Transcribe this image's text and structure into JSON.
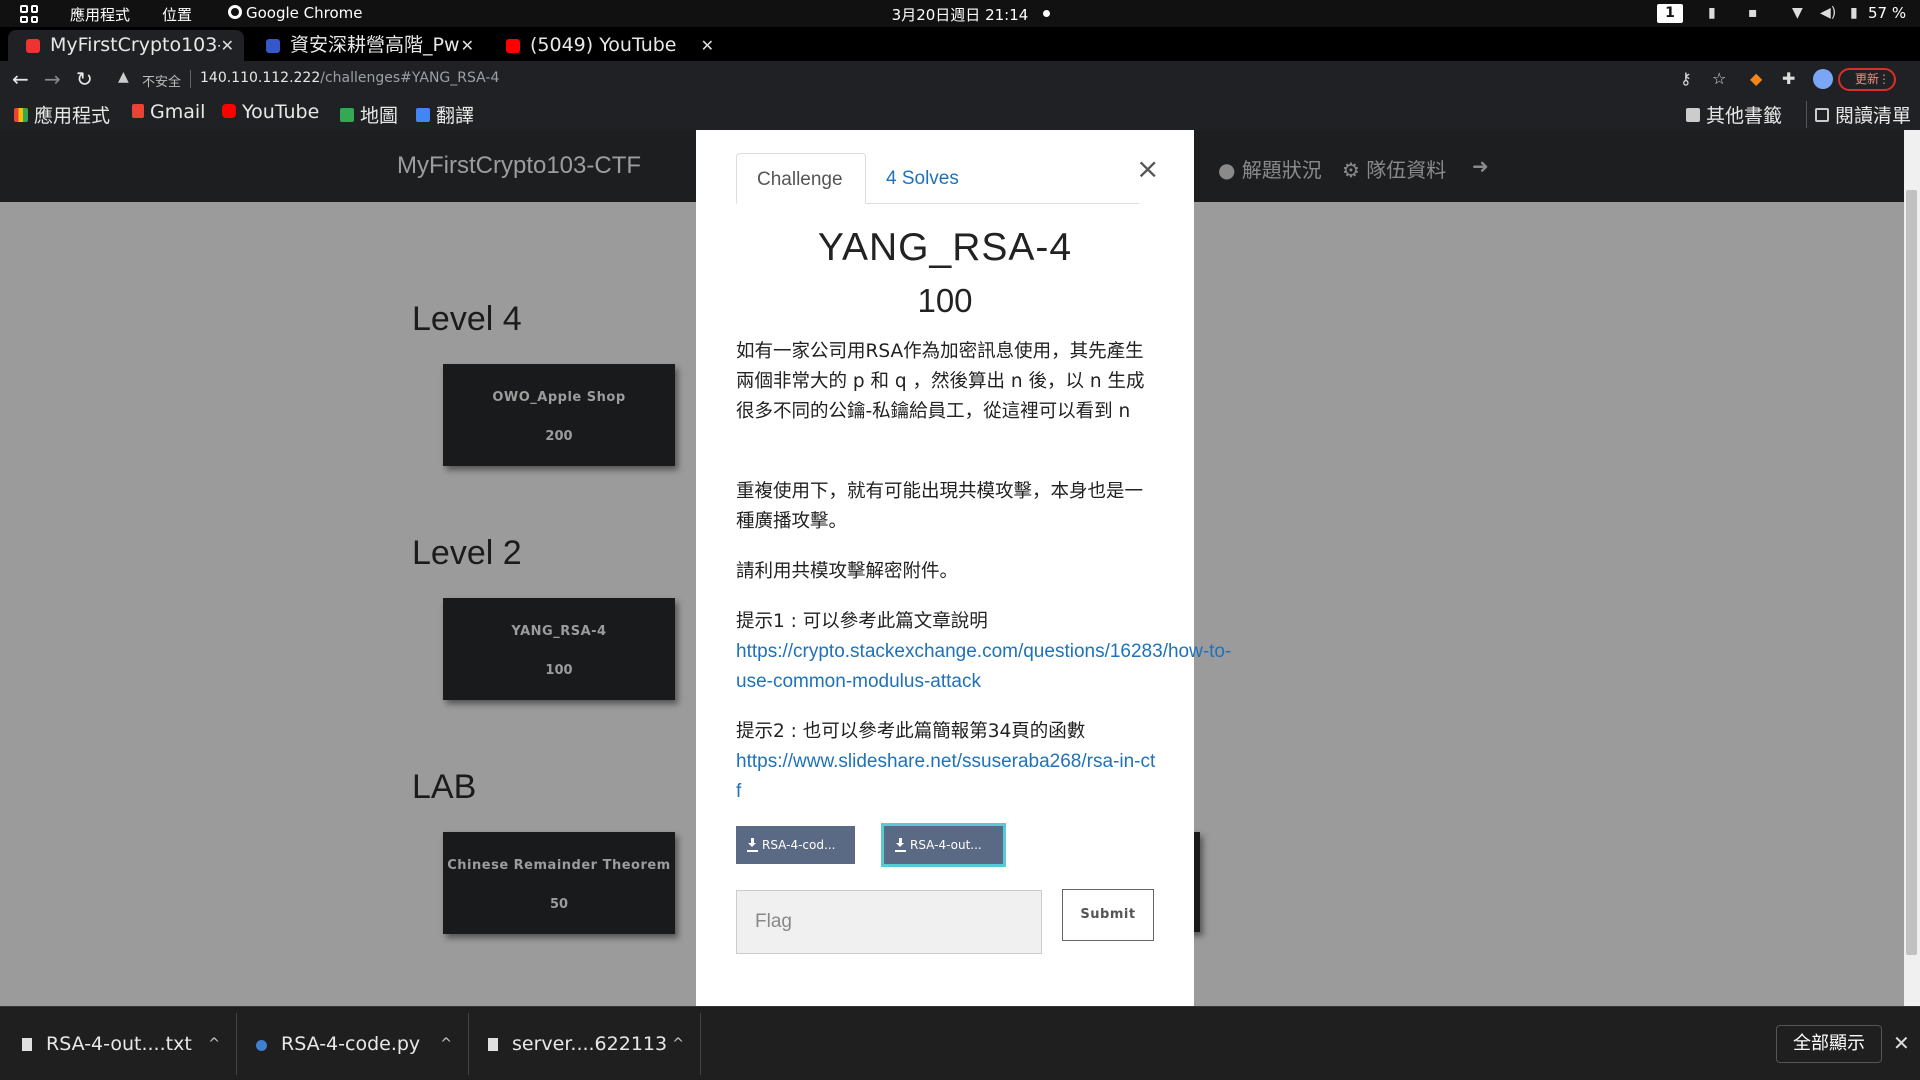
{
  "os_bar": {
    "apps_label": "應用程式",
    "places_label": "位置",
    "active_app": "Google Chrome",
    "clock": "3月20日週日  21:14",
    "workspace": "1",
    "battery": "57 %"
  },
  "tabs": [
    {
      "title": "MyFirstCrypto103-CTF",
      "active": true
    },
    {
      "title": "資安深耕營高階_Pw",
      "active": false
    },
    {
      "title": "(5049) YouTube",
      "active": false
    }
  ],
  "address_bar": {
    "security_label": "不安全",
    "url_host": "140.110.112.222",
    "url_path": "/challenges#YANG_RSA-4",
    "update_label": "更新"
  },
  "bookmarks": {
    "items": [
      "應用程式",
      "Gmail",
      "YouTube",
      "地圖",
      "翻譯"
    ],
    "other": "其他書籤",
    "reading_list": "閱讀清單"
  },
  "site": {
    "brand": "MyFirstCrypto103-CTF",
    "nav": [
      "解題狀況",
      "隊伍資料"
    ]
  },
  "levels": [
    {
      "title": "Level 4",
      "cards": [
        {
          "name": "OWO_Apple Shop",
          "value": "200"
        }
      ]
    },
    {
      "title": "Level 2",
      "cards": [
        {
          "name": "YANG_RSA-4",
          "value": "100"
        }
      ]
    },
    {
      "title": "LAB",
      "cards": [
        {
          "name": "Chinese Remainder Theorem",
          "value": "50"
        }
      ]
    }
  ],
  "modal": {
    "tab_challenge": "Challenge",
    "tab_solves": "4 Solves",
    "title": "YANG_RSA-4",
    "value": "100",
    "paragraphs": [
      "如有一家公司用RSA作為加密訊息使用，其先產生兩個非常大的 p 和 q ，然後算出 n 後，以 n 生成很多不同的公鑰-私鑰給員工，從這裡可以看到 n",
      "重複使用下，就有可能出現共模攻擊，本身也是一種廣播攻擊。",
      "請利用共模攻擊解密附件。"
    ],
    "hint1_label": "提示1 : 可以參考此篇文章說明",
    "hint1_url": "https://crypto.stackexchange.com/questions/16283/how-to-use-common-modulus-attack",
    "hint2_label": "提示2 : 也可以參考此篇簡報第34頁的函數",
    "hint2_url": "https://www.slideshare.net/ssuseraba268/rsa-in-ctf",
    "files": [
      "RSA-4-cod...",
      "RSA-4-out..."
    ],
    "flag_placeholder": "Flag",
    "submit_label": "Submit"
  },
  "downloads": {
    "items": [
      "RSA-4-out....txt",
      "RSA-4-code.py",
      "server....622113"
    ],
    "show_all": "全部顯示"
  },
  "colors": {
    "link": "#1f72b9",
    "download_button": "#5a6a85",
    "focus_ring": "#5bc8d8",
    "nav_bg": "#1c1e20",
    "card_bg": "#181a1c"
  }
}
